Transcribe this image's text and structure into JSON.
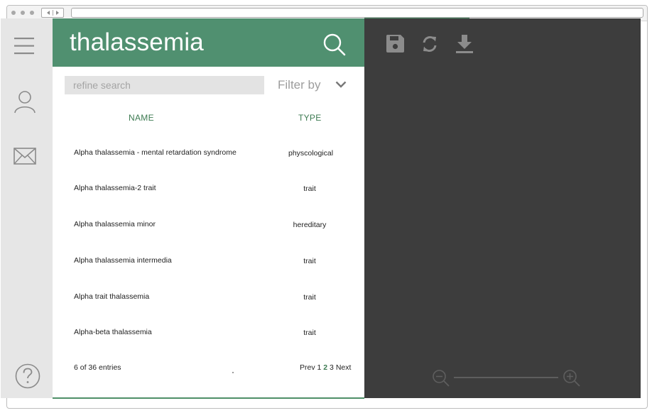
{
  "header": {
    "title": "thalassemia"
  },
  "search": {
    "placeholder": "refine search",
    "filter_label": "Filter by"
  },
  "table": {
    "columns": [
      "NAME",
      "TYPE"
    ],
    "rows": [
      {
        "name": "Alpha thalassemia - mental retardation syndrome",
        "type": "physcological"
      },
      {
        "name": "Alpha thalassemia-2 trait",
        "type": "trait"
      },
      {
        "name": "Alpha thalassemia minor",
        "type": "hereditary"
      },
      {
        "name": "Alpha thalassemia intermedia",
        "type": "trait"
      },
      {
        "name": "Alpha trait thalassemia",
        "type": "trait"
      },
      {
        "name": "Alpha-beta thalassemia",
        "type": "trait"
      }
    ]
  },
  "footer": {
    "entries": "6 of 36 entries",
    "pager": {
      "prev": "Prev",
      "pages": [
        "1",
        "2",
        "3"
      ],
      "current": "2",
      "next": "Next"
    }
  },
  "icons": {
    "rail": [
      "menu-icon",
      "user-icon",
      "mail-icon",
      "help-icon"
    ],
    "toolbar": [
      "save-icon",
      "refresh-icon",
      "download-icon"
    ],
    "zoom": [
      "zoom-out-icon",
      "zoom-in-icon"
    ]
  },
  "colors": {
    "accent": "#509070",
    "dark_panel": "#3d3d3d",
    "rail": "#e6e6e6",
    "accent_text": "#3c7a51"
  }
}
